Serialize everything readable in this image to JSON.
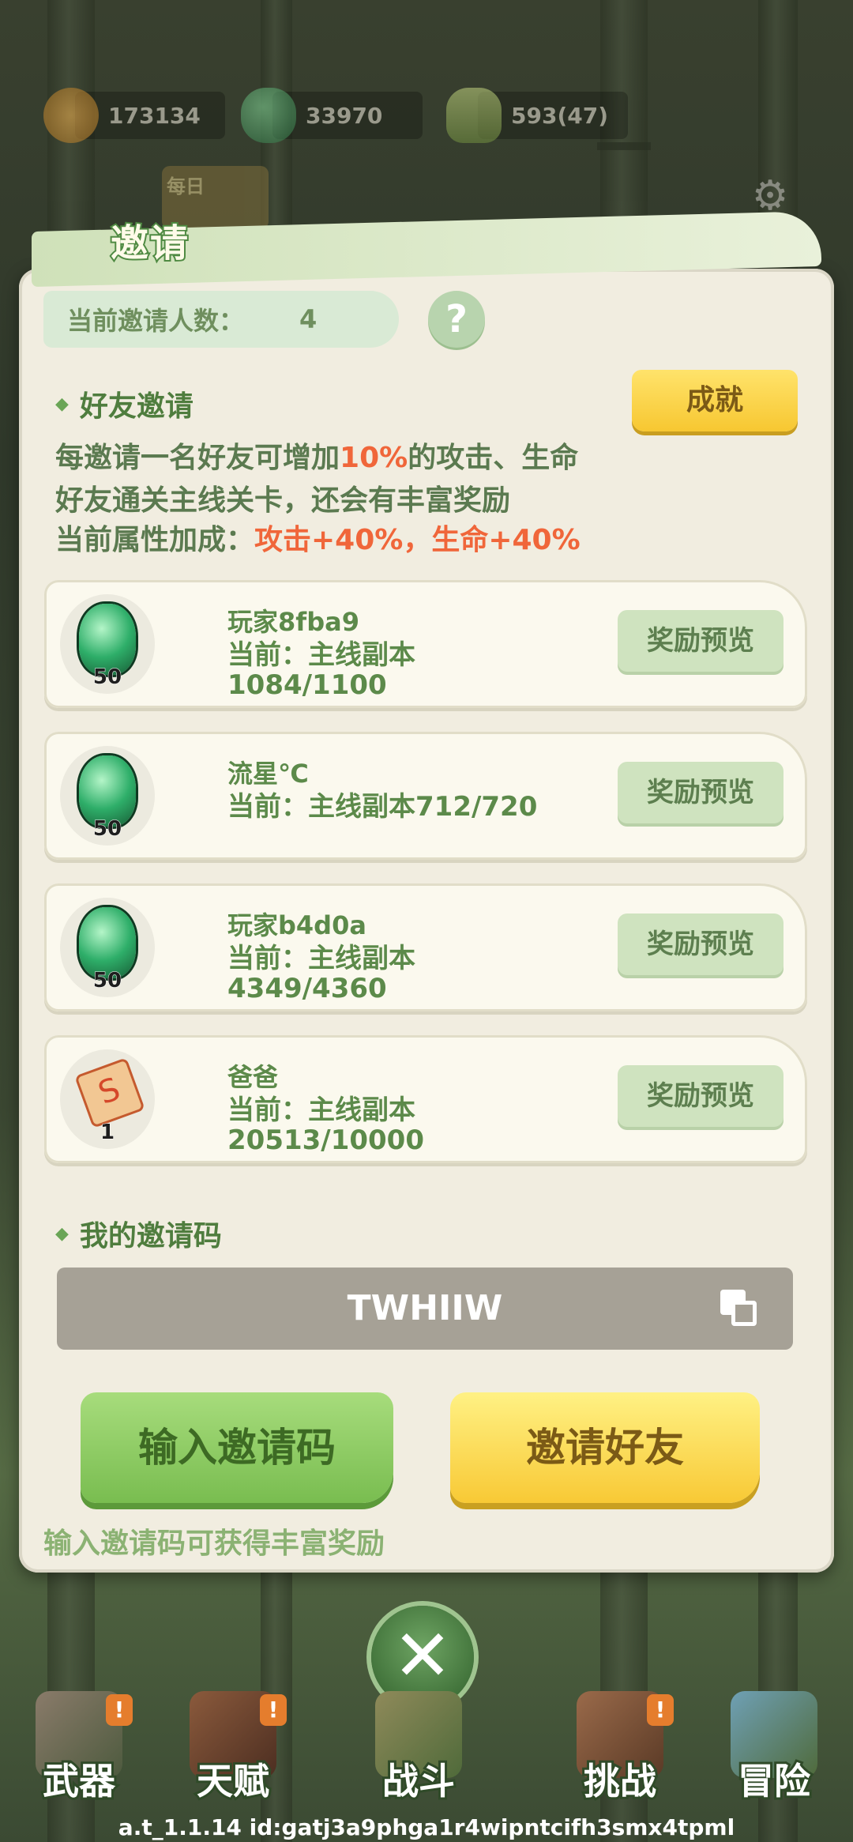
{
  "resources": [
    {
      "icon": "paw-coin-icon",
      "value": "173134"
    },
    {
      "icon": "green-gem-icon",
      "value": "33970"
    },
    {
      "icon": "bamboo-shoot-icon",
      "value": "593(47)"
    }
  ],
  "daily_label": "每日",
  "dialog": {
    "title": "邀请",
    "invite_count_label": "当前邀请人数：",
    "invite_count": "4",
    "help_symbol": "?",
    "friend_section_title": "好友邀请",
    "achievement_label": "成就",
    "desc_line1_prefix": "每邀请一名好友可增加",
    "desc_line1_highlight": "10%",
    "desc_line1_suffix": "的攻击、生命",
    "desc_line2": "好友通关主线关卡，还会有丰富奖励",
    "desc_line3_prefix": "当前属性加成：",
    "desc_line3_highlight": "攻击+40%，生命+40%",
    "friends": [
      {
        "name": "玩家8fba9",
        "progress": "当前：主线副本1084/1100",
        "reward_icon": "green-gem-icon",
        "reward_qty": "50",
        "preview_label": "奖励预览"
      },
      {
        "name": "流星℃",
        "progress": "当前：主线副本712/720",
        "reward_icon": "green-gem-icon",
        "reward_qty": "50",
        "preview_label": "奖励预览"
      },
      {
        "name": "玩家b4d0a",
        "progress": "当前：主线副本4349/4360",
        "reward_icon": "green-gem-icon",
        "reward_qty": "50",
        "preview_label": "奖励预览"
      },
      {
        "name": "爸爸",
        "progress": "当前：主线副本20513/10000",
        "reward_icon": "scroll-icon",
        "reward_qty": "1",
        "preview_label": "奖励预览"
      }
    ],
    "code_section_title": "我的邀请码",
    "invite_code": "TWHIIW",
    "enter_code_label": "输入邀请码",
    "invite_friends_label": "邀请好友",
    "hint": "输入邀请码可获得丰富奖励"
  },
  "close_symbol": "✕",
  "bottom_nav": [
    {
      "label": "武器",
      "icon": "axe-icon",
      "badge": "!"
    },
    {
      "label": "天赋",
      "icon": "book-icon",
      "badge": "!"
    },
    {
      "label": "战斗",
      "icon": "scroll-icon",
      "badge": ""
    },
    {
      "label": "挑战",
      "icon": "wooden-dummy-icon",
      "badge": "!"
    },
    {
      "label": "冒险",
      "icon": "map-icon",
      "badge": ""
    }
  ],
  "footer": "a.t_1.1.14 id:gatj3a9phga1r4wipntcifh3smx4tpml",
  "colors": {
    "accent_green": "#5c8a4a",
    "highlight_orange": "#f0663a",
    "yellow_button": "#f8c935",
    "green_button": "#79bd50"
  }
}
